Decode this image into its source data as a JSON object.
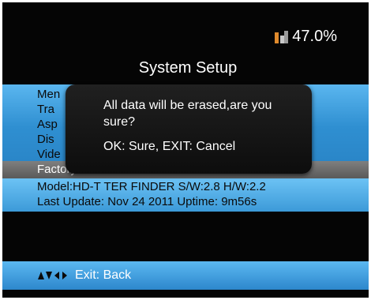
{
  "status": {
    "value": "47.0%",
    "icon": "signal-bars-icon"
  },
  "header": {
    "title": "System Setup"
  },
  "menu": {
    "items": [
      {
        "label": "Men"
      },
      {
        "label": "Tra"
      },
      {
        "label": "Asp"
      },
      {
        "label": "Dis"
      },
      {
        "label": "Vide"
      }
    ],
    "selected": "Factory Reset"
  },
  "info": {
    "model_line": "Model:HD-T TER FINDER  S/W:2.8  H/W:2.2",
    "update_line": "Last Update: Nov 24 2011  Uptime: 9m56s"
  },
  "dialog": {
    "message": "All data will be erased,are you sure?",
    "hint": "OK: Sure, EXIT: Cancel"
  },
  "footer": {
    "label": "Exit: Back"
  },
  "colors": {
    "accent_blue": "#2f8fd1",
    "background": "#050505",
    "dialog": "#161616"
  }
}
